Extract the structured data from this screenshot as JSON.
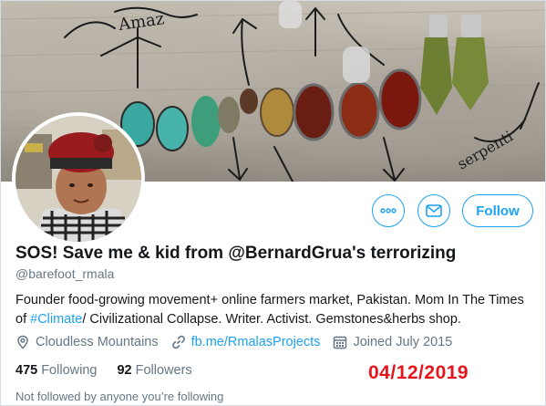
{
  "profile": {
    "display_name": "SOS! Save me & kid from @BernardGrua's terrorizing",
    "handle": "@barefoot_rmala",
    "bio_parts": {
      "before": "Founder food-growing movement+ online farmers market, Pakistan. Mom In The Times of ",
      "hashtag": "#Climate",
      "after": "/ Civilizational Collapse. Writer. Activist. Gemstones&herbs shop."
    },
    "location": "Cloudless Mountains",
    "website": "fb.me/RmalasProjects",
    "joined": "Joined July 2015",
    "following_count": "475",
    "following_label": "Following",
    "followers_count": "92",
    "followers_label": "Followers",
    "not_followed_text": "Not followed by anyone you’re following"
  },
  "actions": {
    "more_icon": "more-horizontal-icon",
    "message_icon": "envelope-icon",
    "follow_label": "Follow"
  },
  "annotation": {
    "date_stamp": "04/12/2019",
    "color": "#e8141b"
  },
  "colors": {
    "accent": "#1da1f2",
    "text": "#14171a",
    "muted": "#657786"
  }
}
